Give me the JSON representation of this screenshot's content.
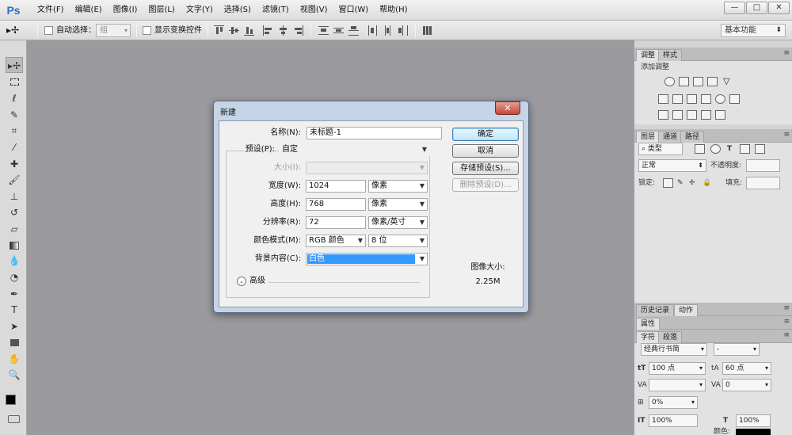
{
  "app": {
    "logo": "Ps",
    "menus": [
      "文件(F)",
      "编辑(E)",
      "图像(I)",
      "图层(L)",
      "文字(Y)",
      "选择(S)",
      "滤镜(T)",
      "视图(V)",
      "窗口(W)",
      "帮助(H)"
    ],
    "window_buttons": [
      "—",
      "□",
      "✕"
    ]
  },
  "options_bar": {
    "auto_select_label": "自动选择：",
    "auto_select_value": "组",
    "show_transform_label": "显示变换控件",
    "workspace": "基本功能"
  },
  "panels": {
    "adjustments_tabs": [
      "调整",
      "样式"
    ],
    "adjustments_add_label": "添加调整",
    "layers_tabs": [
      "图层",
      "通道",
      "路径"
    ],
    "layers_filter": "类型",
    "blend_mode": "正常",
    "opacity_label": "不透明度:",
    "lock_label": "锁定:",
    "fill_label": "填充:",
    "history_tabs": [
      "历史记录",
      "动作"
    ],
    "properties_tab": "属性",
    "character_tabs": [
      "字符",
      "段落"
    ],
    "font_family": "经典行书简",
    "font_style": "-",
    "font_size": "100 点",
    "leading": "60 点",
    "tracking": "0",
    "scale_percent": "0%",
    "vscale": "100%",
    "hscale": "100%",
    "color_label": "颜色:"
  },
  "dialog": {
    "title": "新建",
    "close": "✕",
    "name_label": "名称(N):",
    "name_value": "未标题-1",
    "preset_label": "预设(P):",
    "preset_value": "自定",
    "size_label": "大小(I):",
    "width_label": "宽度(W):",
    "width_value": "1024",
    "width_unit": "像素",
    "height_label": "高度(H):",
    "height_value": "768",
    "height_unit": "像素",
    "resolution_label": "分辨率(R):",
    "resolution_value": "72",
    "resolution_unit": "像素/英寸",
    "color_mode_label": "颜色模式(M):",
    "color_mode_value": "RGB 颜色",
    "bit_depth": "8 位",
    "background_label": "背景内容(C):",
    "background_value": "白色",
    "advanced_label": "高级",
    "ok": "确定",
    "cancel": "取消",
    "save_preset": "存储预设(S)...",
    "delete_preset": "删除预设(D)...",
    "image_size_label": "图像大小:",
    "image_size_value": "2.25M"
  }
}
